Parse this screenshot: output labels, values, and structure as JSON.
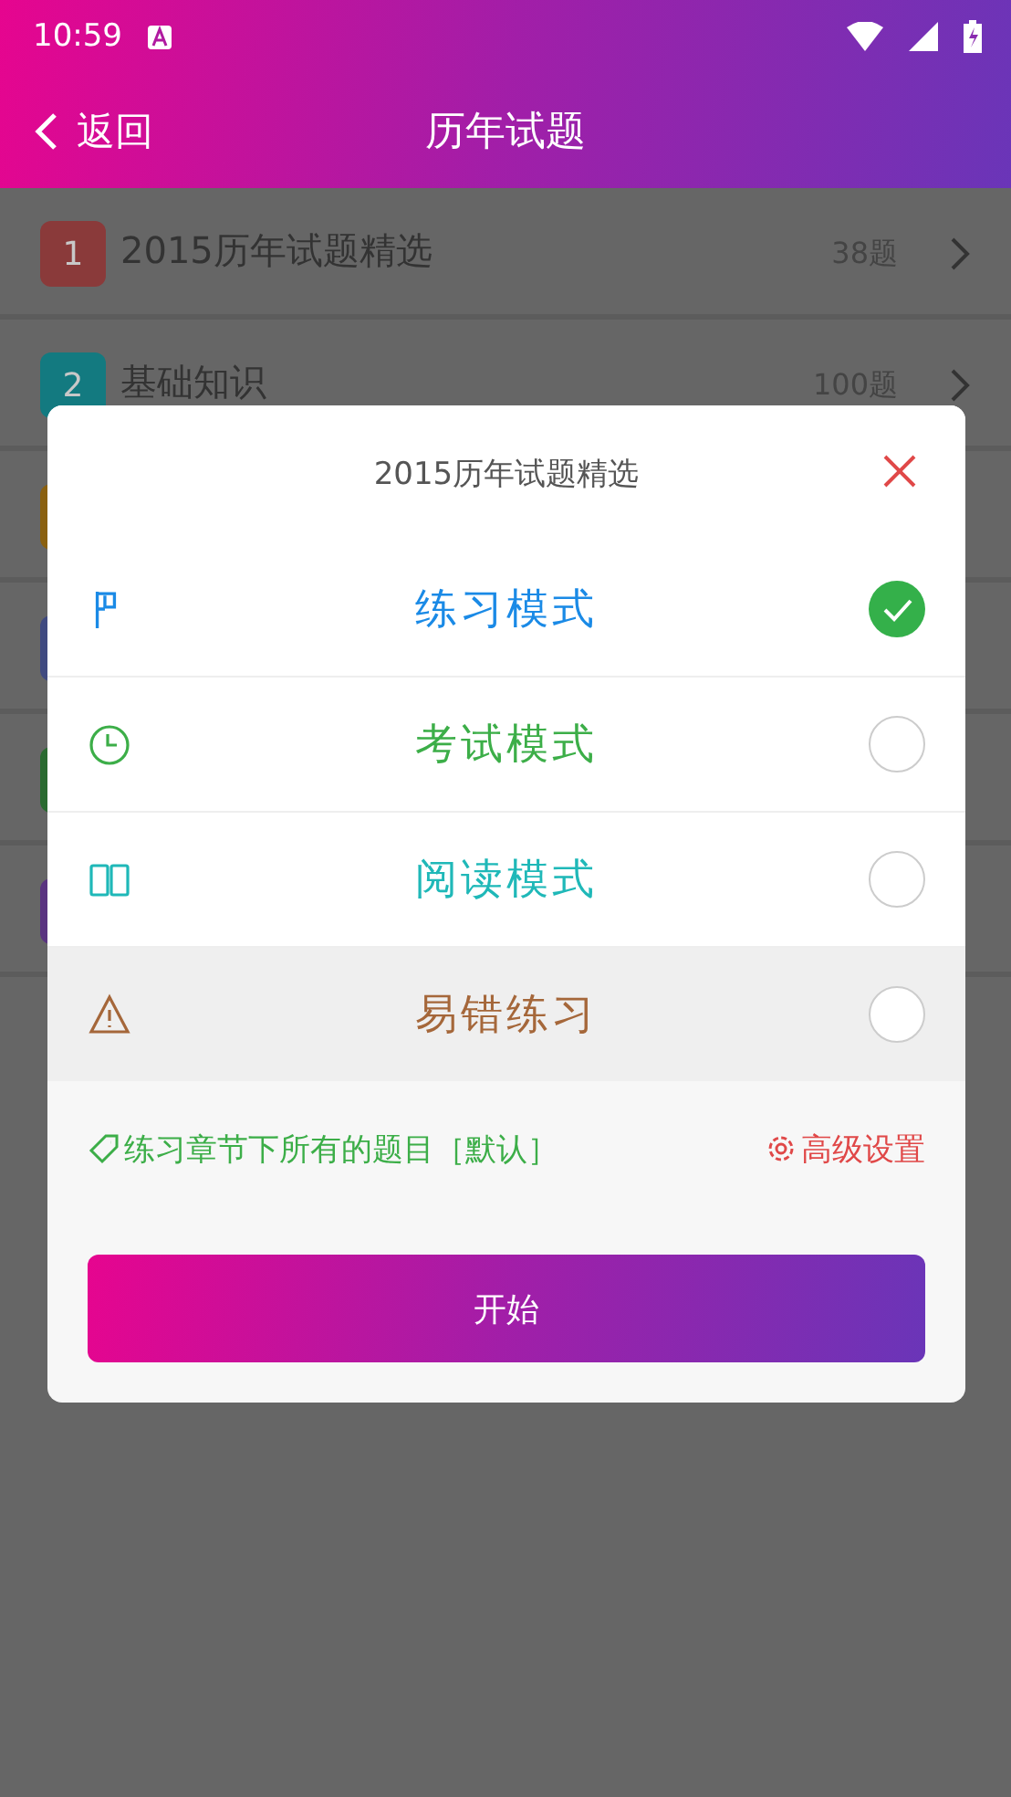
{
  "status_bar": {
    "time": "10:59"
  },
  "header": {
    "back": "返回",
    "title": "历年试题"
  },
  "chapters": [
    {
      "number": "1",
      "title": "2015历年试题精选",
      "count": "38题",
      "color": "#8a3a3a"
    },
    {
      "number": "2",
      "title": "基础知识",
      "count": "100题",
      "color": "#137a80"
    },
    {
      "color": "#8a6010"
    },
    {
      "color": "#404a80"
    },
    {
      "color": "#2a6a30"
    },
    {
      "color": "#5a3480"
    }
  ],
  "dialog": {
    "title": "2015历年试题精选",
    "modes": [
      {
        "kind": "flag",
        "label": "练习模式",
        "color": "#1a8ae6",
        "selected": true,
        "highlighted": false
      },
      {
        "kind": "clock",
        "label": "考试模式",
        "color": "#3cae48",
        "selected": false,
        "highlighted": false
      },
      {
        "kind": "book",
        "label": "阅读模式",
        "color": "#1fb8b8",
        "selected": false,
        "highlighted": false
      },
      {
        "kind": "warning",
        "label": "易错练习",
        "color": "#a5673a",
        "selected": false,
        "highlighted": true
      }
    ],
    "scope": "练习章节下所有的题目［默认］",
    "settings": "高级设置",
    "start": "开始"
  }
}
